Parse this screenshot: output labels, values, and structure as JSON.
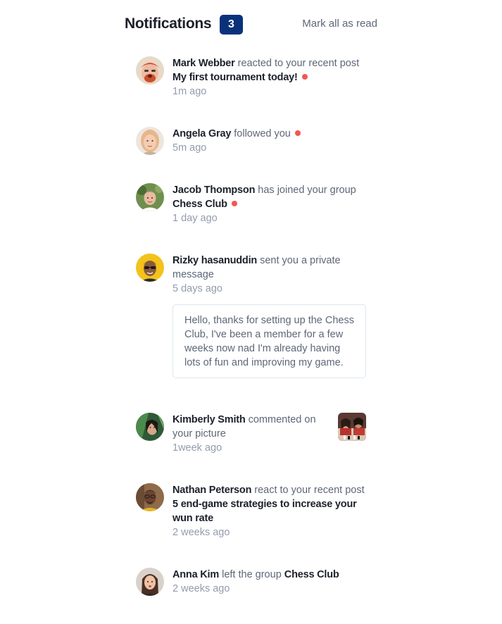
{
  "header": {
    "title": "Notifications",
    "unread_count": "3",
    "mark_all_label": "Mark all as read"
  },
  "colors": {
    "badge": "#0a327b",
    "unread_dot": "#f65552",
    "name_text": "#1c202b",
    "body_text": "#5e6778",
    "time_text": "#939cad"
  },
  "notifications": [
    {
      "name": "Mark Webber",
      "action": "reacted to your recent post",
      "object": "My first tournament today!",
      "time": "1m ago",
      "unread": true
    },
    {
      "name": "Angela Gray",
      "action": "followed you",
      "time": "5m ago",
      "unread": true
    },
    {
      "name": "Jacob Thompson",
      "action": "has joined your group",
      "object": "Chess Club",
      "time": "1 day ago",
      "unread": true
    },
    {
      "name": "Rizky hasanuddin",
      "action": "sent you a private message",
      "time": "5 days ago",
      "unread": false,
      "message": "Hello, thanks for setting up the Chess Club, I've been a member for a few weeks now nad I'm already having lots of fun and improving my game."
    },
    {
      "name": "Kimberly Smith",
      "action": "commented on your picture",
      "time": "1week ago",
      "unread": false
    },
    {
      "name": "Nathan Peterson",
      "action": "react to your recent post",
      "object": "5 end-game strategies to increase your wun rate",
      "time": "2 weeks ago",
      "unread": false
    },
    {
      "name": "Anna Kim",
      "action": "left the group",
      "object": "Chess Club",
      "time": "2 weeks ago",
      "unread": false
    }
  ]
}
